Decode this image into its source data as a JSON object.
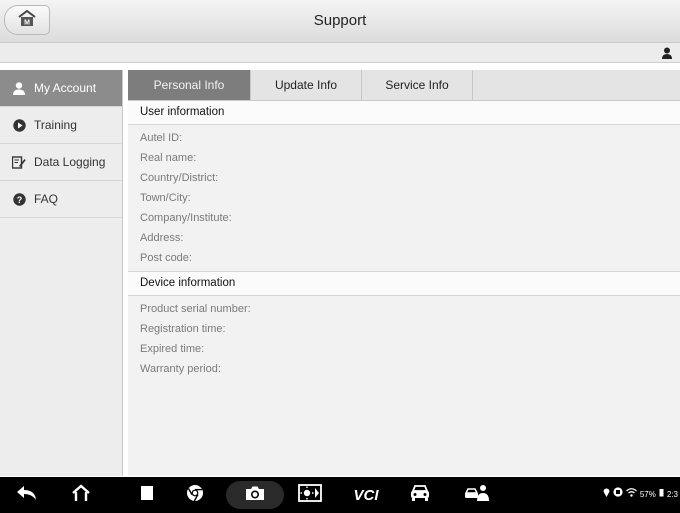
{
  "titlebar": {
    "title": "Support",
    "home_icon": "home-icon"
  },
  "subbar": {
    "user_icon": "user-icon"
  },
  "sidebar": {
    "items": [
      {
        "label": "My Account",
        "icon": "user-icon",
        "active": true
      },
      {
        "label": "Training",
        "icon": "play-icon",
        "active": false
      },
      {
        "label": "Data Logging",
        "icon": "edit-icon",
        "active": false
      },
      {
        "label": "FAQ",
        "icon": "help-icon",
        "active": false
      }
    ]
  },
  "tabs": [
    {
      "label": "Personal Info",
      "active": true
    },
    {
      "label": "Update Info",
      "active": false
    },
    {
      "label": "Service Info",
      "active": false
    }
  ],
  "user_section": {
    "header": "User information",
    "fields": [
      "Autel ID:",
      "Real name:",
      "Country/District:",
      "Town/City:",
      "Company/Institute:",
      "Address:",
      "Post code:"
    ]
  },
  "device_section": {
    "header": "Device information",
    "fields": [
      "Product serial number:",
      "Registration time:",
      "Expired time:",
      "Warranty period:"
    ]
  },
  "navbar": {
    "vci_label": "VCI",
    "status": {
      "battery": "57%",
      "time": "2:3"
    }
  },
  "colors": {
    "active_tab": "#7d7d7d",
    "active_sidebar": "#8c8c8c",
    "navbar": "#000000"
  }
}
